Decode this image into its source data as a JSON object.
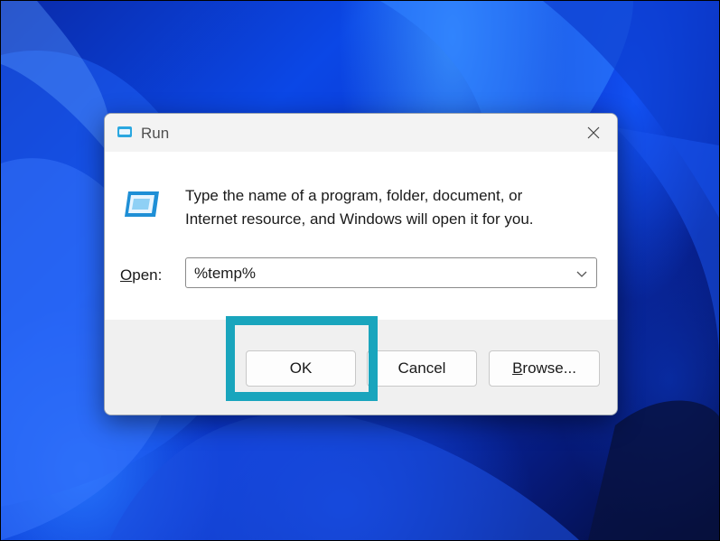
{
  "dialog": {
    "title": "Run",
    "description_line1": "Type the name of a program, folder, document, or",
    "description_line2": "Internet resource, and Windows will open it for you.",
    "open_label_mnemonic": "O",
    "open_label_rest": "pen:",
    "open_value": "%temp%",
    "buttons": {
      "ok": "OK",
      "cancel": "Cancel",
      "browse_mnemonic": "B",
      "browse_rest": "rowse..."
    }
  },
  "icons": {
    "title": "run-icon",
    "content": "run-icon",
    "close": "close-icon",
    "dropdown": "chevron-down-icon"
  },
  "colors": {
    "highlight": "#19a5bd",
    "wallpaper_accent": "#0b47e6"
  }
}
